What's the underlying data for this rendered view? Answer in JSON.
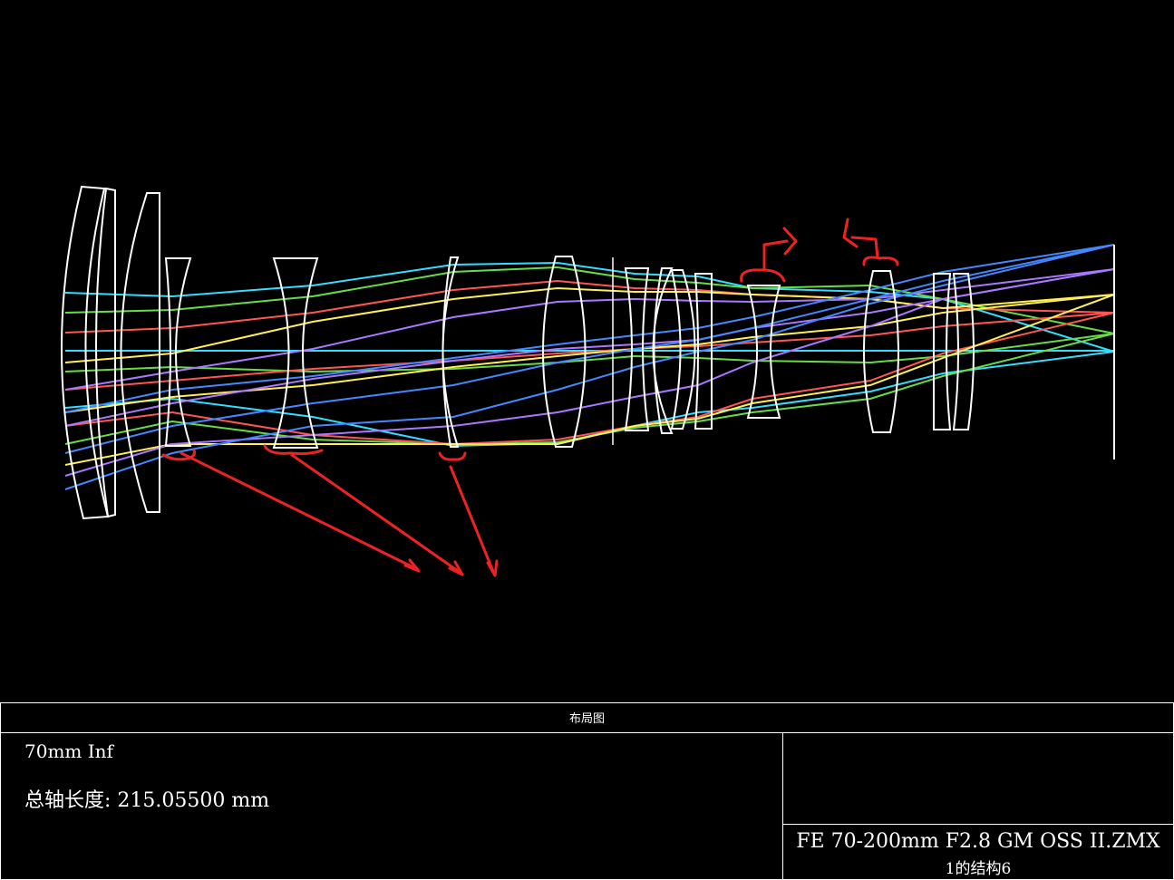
{
  "panel": {
    "title": "布局图",
    "zoom_info": "70mm Inf",
    "axial_length_label": "总轴长度:",
    "axial_length_value": "215.05500 mm",
    "file_name": "FE 70-200mm F2.8 GM OSS II.ZMX",
    "configuration": "1的结构6"
  },
  "colors": {
    "background": "#000000",
    "lens_outline": "#ffffff",
    "annotation": "#ee2222",
    "ray_fields": [
      "#33ddff",
      "#66dd44",
      "#ff5555",
      "#ffee55",
      "#aa77ff",
      "#4488ff"
    ]
  }
}
